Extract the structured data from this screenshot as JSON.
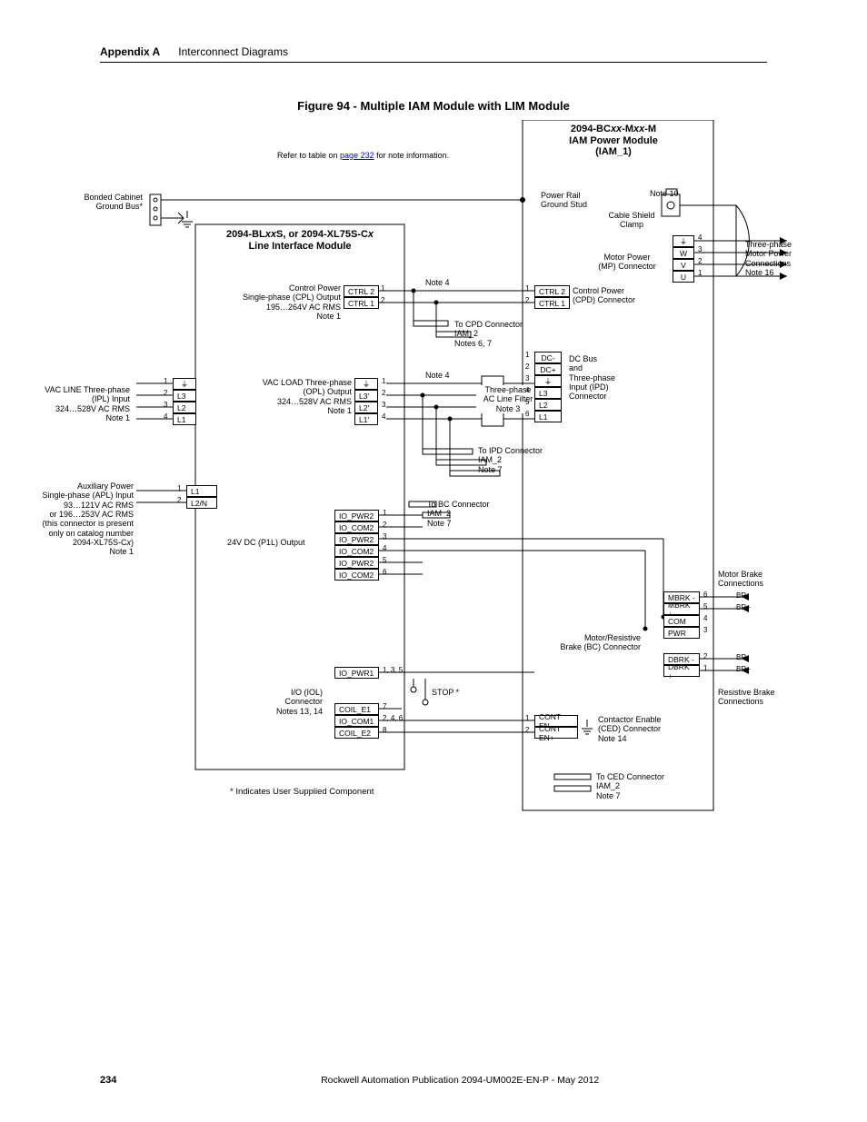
{
  "header": {
    "appendix": "Appendix A",
    "section": "Interconnect Diagrams"
  },
  "figure": {
    "title": "Figure 94 - Multiple IAM Module with LIM Module",
    "refer_text_prefix": "Refer to table on ",
    "refer_link": "page 232",
    "refer_text_suffix": " for note information.",
    "footnote": "* Indicates User Supplied Component"
  },
  "iam": {
    "title_l1": "2094-BC",
    "title_ital1": "xx",
    "title_mid": "-M",
    "title_ital2": "xx",
    "title_end": "-M",
    "title_l2": "IAM Power Module",
    "title_l3": "(IAM_1)"
  },
  "labels": {
    "bonded_ground": "Bonded Cabinet\nGround Bus*",
    "lim_title_l1": "2094-BLxxS, or 2094-XL75S-Cx",
    "lim_title_l2": "Line Interface Module",
    "control_power_cpl_l1": "Control Power",
    "control_power_cpl_l2": "Single-phase (CPL) Output",
    "control_power_cpl_l3": "195…264V AC RMS",
    "control_power_cpl_l4": "Note 1",
    "vac_line_l1": "VAC LINE Three-phase",
    "vac_line_l2": "(IPL) Input",
    "vac_line_l3": "324…528V AC RMS",
    "vac_line_l4": "Note 1",
    "aux_power_l1": "Auxiliary Power",
    "aux_power_l2": "Single-phase (APL) Input",
    "aux_power_l3": "93…121V AC RMS",
    "aux_power_l4": "or 196…253V AC RMS",
    "aux_power_l5": "(this connector is present",
    "aux_power_l6": "only on catalog number",
    "aux_power_l7": "2094-XL75S-Cx)",
    "aux_power_l8": "Note 1",
    "vac_load_l1": "VAC LOAD Three-phase",
    "vac_load_l2": "(OPL) Output",
    "vac_load_l3": "324…528V AC RMS",
    "vac_load_l4": "Note 1",
    "p1l": "24V DC (P1L) Output",
    "iol_l1": "I/O (IOL)",
    "iol_l2": "Connector",
    "iol_l3": "Notes 13, 14",
    "stop": "STOP *",
    "power_rail_l1": "Power Rail",
    "power_rail_l2": "Ground Stud",
    "cable_shield_l1": "Cable Shield",
    "cable_shield_l2": "Clamp",
    "note10": "Note 10",
    "mp_l1": "Motor Power",
    "mp_l2": "(MP) Connector",
    "mp_out_l1": "Three-phase",
    "mp_out_l2": "Motor Power",
    "mp_out_l3": "Connections",
    "mp_out_l4": "Note 16",
    "cpd_l1": "Control Power",
    "cpd_l2": "(CPD) Connector",
    "dcbus_l1": "DC Bus",
    "dcbus_l2": "and",
    "dcbus_l3": "Three-phase",
    "dcbus_l4": "Input (IPD)",
    "dcbus_l5": "Connector",
    "aclinefilter_l1": "Three-phase",
    "aclinefilter_l2": "AC Line Filter",
    "aclinefilter_l3": "Note 3",
    "to_cpd_l1": "To CPD Connector",
    "to_cpd_l2": "IAM_2",
    "to_cpd_l3": "Notes 6, 7",
    "to_ipd_l1": "To IPD Connector",
    "to_ipd_l2": "IAM_2",
    "to_ipd_l3": "Note 7",
    "to_bc_l1": "To BC Connector",
    "to_bc_l2": "IAM_2",
    "to_bc_l3": "Note 7",
    "to_ced_l1": "To CED Connector",
    "to_ced_l2": "IAM_2",
    "to_ced_l3": "Note 7",
    "note4": "Note 4",
    "bc_l1": "Motor/Resistive",
    "bc_l2": "Brake (BC) Connector",
    "mbrake_l1": "Motor Brake",
    "mbrake_l2": "Connections",
    "rbrake_l1": "Resistive Brake",
    "rbrake_l2": "Connections",
    "ced_l1": "Contactor Enable",
    "ced_l2": "(CED) Connector",
    "ced_l3": "Note 14"
  },
  "pins": {
    "ctrl2": "CTRL 2",
    "ctrl1": "CTRL 1",
    "l3": "L3",
    "l2": "L2",
    "l1": "L1",
    "l2n": "L2/N",
    "l3p": "L3'",
    "l2p": "L2'",
    "l1p": "L1'",
    "io_pwr2": "IO_PWR2",
    "io_com2": "IO_COM2",
    "io_pwr1": "IO_PWR1",
    "coil_e1": "COIL_E1",
    "io_com1": "IO_COM1",
    "coil_e2": "COIL_E2",
    "dcminus": "DC-",
    "dcplus": "DC+",
    "w": "W",
    "v": "V",
    "u": "U",
    "mbrkm": "MBRK -",
    "mbrkp": "MBRK +",
    "com": "COM",
    "pwr": "PWR",
    "dbrkm": "DBRK -",
    "dbrkp": "DBRK +",
    "conten_m": "CONT EN-",
    "conten_p": "CONT EN+",
    "brm": "BR-",
    "brp": "BR+",
    "gnd_sym": "⏚"
  },
  "nums": {
    "n1": "1",
    "n2": "2",
    "n3": "3",
    "n4": "4",
    "n5": "5",
    "n6": "6",
    "n7": "7",
    "n8": "8",
    "p135": "1, 3, 5",
    "p246": "2, 4, 6"
  },
  "footer": {
    "page": "234",
    "publication": "Rockwell Automation Publication 2094-UM002E-EN-P - May 2012"
  }
}
